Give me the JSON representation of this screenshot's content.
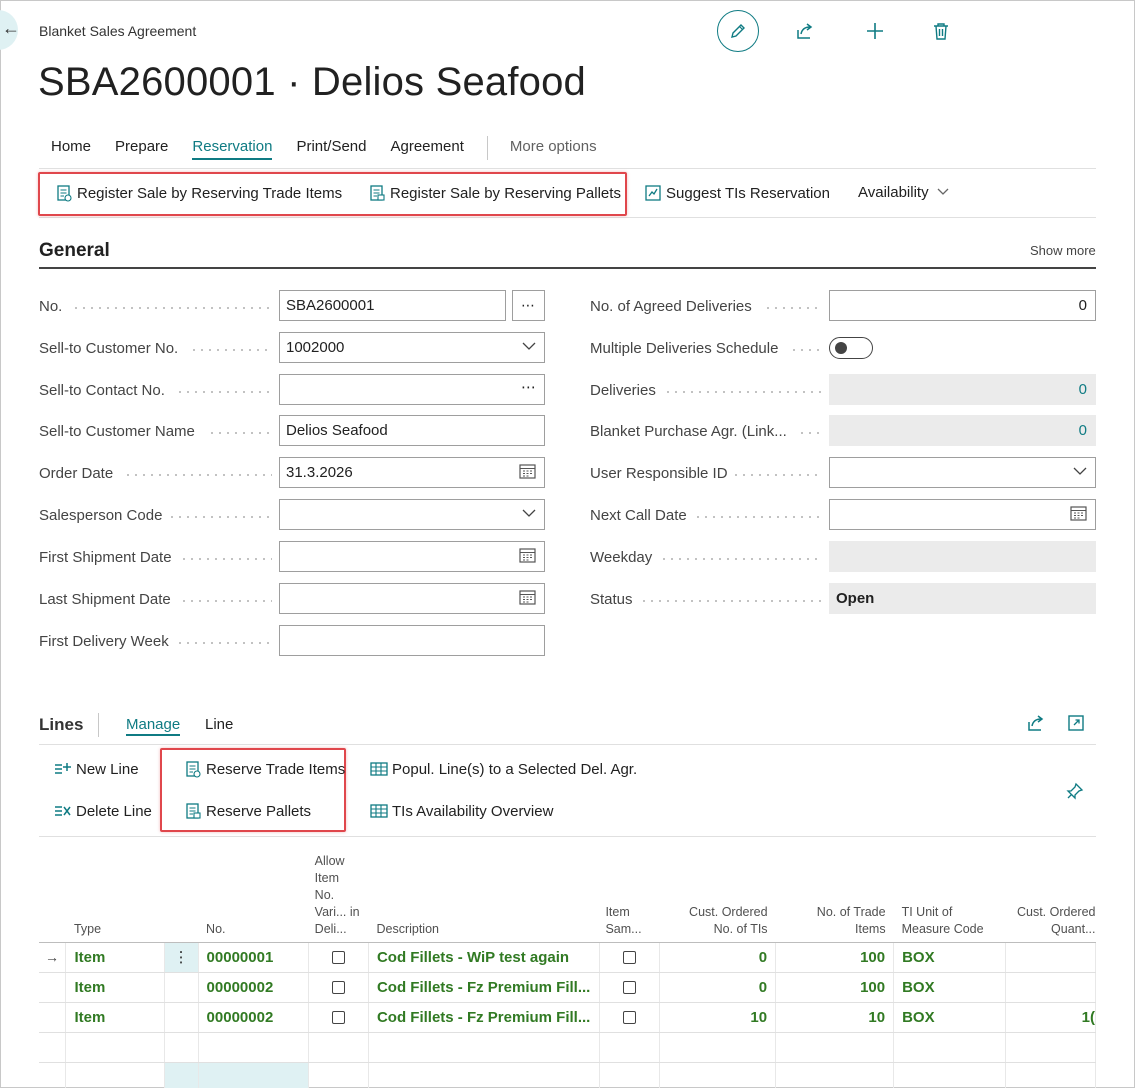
{
  "header": {
    "caption": "Blanket Sales Agreement",
    "title": "SBA2600001 · Delios Seafood"
  },
  "tabs": [
    "Home",
    "Prepare",
    "Reservation",
    "Print/Send",
    "Agreement"
  ],
  "tabs_active": "Reservation",
  "more_options": "More options",
  "ribbon": {
    "register_trade_items": "Register Sale by Reserving Trade Items",
    "register_pallets": "Register Sale by Reserving Pallets",
    "suggest_tis": "Suggest TIs Reservation",
    "availability": "Availability"
  },
  "general": {
    "title": "General",
    "show_more": "Show more",
    "fields_left": [
      {
        "label": "No.",
        "value": "SBA2600001"
      },
      {
        "label": "Sell-to Customer No.",
        "value": "1002000"
      },
      {
        "label": "Sell-to Contact No.",
        "value": ""
      },
      {
        "label": "Sell-to Customer Name",
        "value": "Delios Seafood"
      },
      {
        "label": "Order Date",
        "value": "31.3.2026"
      },
      {
        "label": "Salesperson Code",
        "value": ""
      },
      {
        "label": "First Shipment Date",
        "value": ""
      },
      {
        "label": "Last Shipment Date",
        "value": ""
      },
      {
        "label": "First Delivery Week",
        "value": ""
      }
    ],
    "fields_right": [
      {
        "label": "No. of Agreed Deliveries",
        "value": "0"
      },
      {
        "label": "Multiple Deliveries Schedule",
        "value": ""
      },
      {
        "label": "Deliveries",
        "value": "0"
      },
      {
        "label": "Blanket Purchase Agr. (Link...",
        "value": "0"
      },
      {
        "label": "User Responsible ID",
        "value": ""
      },
      {
        "label": "Next Call Date",
        "value": ""
      },
      {
        "label": "Weekday",
        "value": ""
      },
      {
        "label": "Status",
        "value": "Open"
      }
    ]
  },
  "lines": {
    "title": "Lines",
    "tab_manage": "Manage",
    "tab_line": "Line",
    "actions": {
      "new_line": "New Line",
      "delete_line": "Delete Line",
      "reserve_trade_items": "Reserve Trade Items",
      "reserve_pallets": "Reserve Pallets",
      "popul_lines": "Popul. Line(s) to a Selected Del. Agr.",
      "tis_availability": "TIs Availability Overview"
    },
    "columns": {
      "type": "Type",
      "no": "No.",
      "allow_variant": "Allow Item No. Vari... in Deli...",
      "description": "Description",
      "item_sample": "Item Sam...",
      "cust_ordered_tis": "Cust. Ordered No. of TIs",
      "trade_items": "No. of Trade Items",
      "ti_uom": "TI Unit of Measure Code",
      "cust_ordered_qty": "Cust. Ordered Quant..."
    },
    "rows": [
      {
        "type": "Item",
        "no": "00000001",
        "description": "Cod Fillets - WiP test again",
        "cust_ordered_tis": "0",
        "trade_items": "100",
        "ti_uom": "BOX",
        "cust_ordered_qty": ""
      },
      {
        "type": "Item",
        "no": "00000002",
        "description": "Cod Fillets - Fz Premium Fill...",
        "cust_ordered_tis": "0",
        "trade_items": "100",
        "ti_uom": "BOX",
        "cust_ordered_qty": ""
      },
      {
        "type": "Item",
        "no": "00000002",
        "description": "Cod Fillets - Fz Premium Fill...",
        "cust_ordered_tis": "10",
        "trade_items": "10",
        "ti_uom": "BOX",
        "cust_ordered_qty": "1("
      }
    ]
  },
  "colors": {
    "accent": "#0f7b83",
    "highlight_box": "#e0474c",
    "item_green": "#317a23"
  },
  "icons": [
    "back-arrow-icon",
    "edit-pencil-icon",
    "share-icon",
    "add-icon",
    "delete-icon",
    "calendar-icon",
    "chevron-down-icon",
    "ellipsis-icon",
    "pin-icon",
    "expand-icon"
  ]
}
